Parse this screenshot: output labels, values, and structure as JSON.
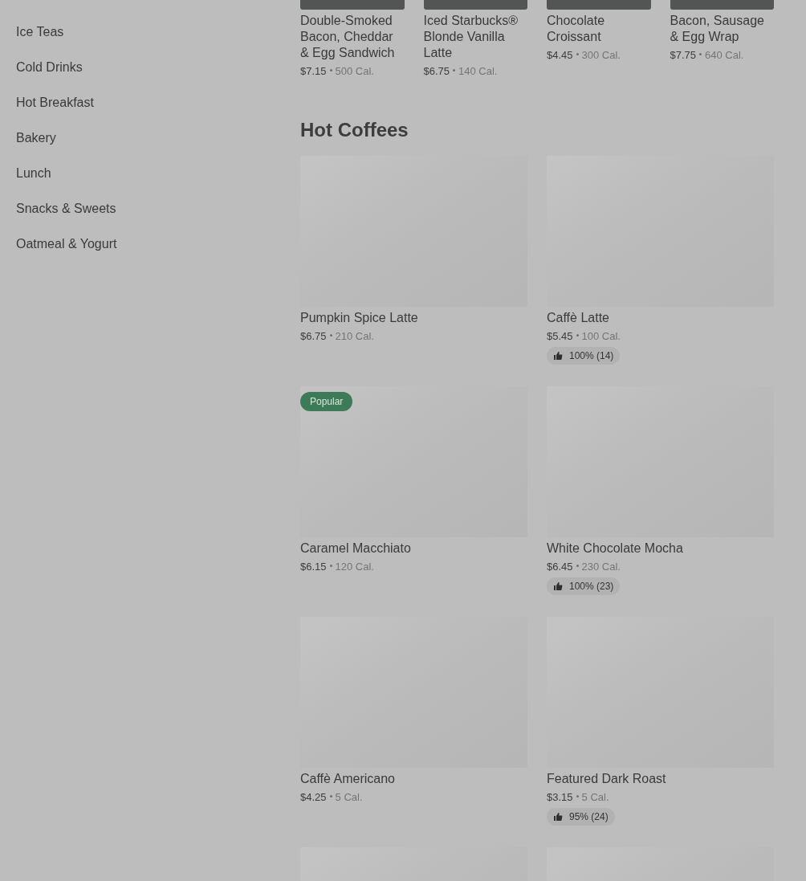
{
  "sidebar": {
    "items": [
      {
        "label": "Ice Teas"
      },
      {
        "label": "Cold Drinks"
      },
      {
        "label": "Hot Breakfast"
      },
      {
        "label": "Bakery"
      },
      {
        "label": "Lunch"
      },
      {
        "label": "Snacks & Sweets"
      },
      {
        "label": "Oatmeal & Yogurt"
      }
    ]
  },
  "carousel": {
    "items": [
      {
        "name": "Double-Smoked Bacon, Cheddar & Egg Sandwich",
        "price": "$7.15",
        "calories": "500 Cal."
      },
      {
        "name": "Iced Starbucks® Blonde Vanilla Latte",
        "price": "$6.75",
        "calories": "140 Cal."
      },
      {
        "name": "Chocolate Croissant",
        "price": "$4.45",
        "calories": "300 Cal."
      },
      {
        "name": "Bacon, Sausage & Egg Wrap",
        "price": "$7.75",
        "calories": "640 Cal."
      }
    ]
  },
  "section": {
    "title": "Hot Coffees",
    "items": [
      {
        "kind": "item",
        "name": "Pumpkin Spice Latte",
        "price": "$6.75",
        "calories": "210 Cal."
      },
      {
        "kind": "item",
        "name": "Caffè Latte",
        "price": "$5.45",
        "calories": "100 Cal.",
        "rating": "100% (14)"
      },
      {
        "kind": "item",
        "badge": "Popular",
        "name": "Caramel Macchiato",
        "price": "$6.15",
        "calories": "120 Cal."
      },
      {
        "kind": "item",
        "name": "White Chocolate Mocha",
        "price": "$6.45",
        "calories": "230 Cal.",
        "rating": "100% (23)"
      },
      {
        "kind": "item",
        "name": "Caffè Americano",
        "price": "$4.25",
        "calories": "5 Cal."
      },
      {
        "kind": "item",
        "name": "Featured Dark Roast",
        "price": "$3.15",
        "calories": "5 Cal.",
        "rating": "95% (24)"
      },
      {
        "kind": "image_only"
      },
      {
        "kind": "image_only"
      }
    ]
  }
}
